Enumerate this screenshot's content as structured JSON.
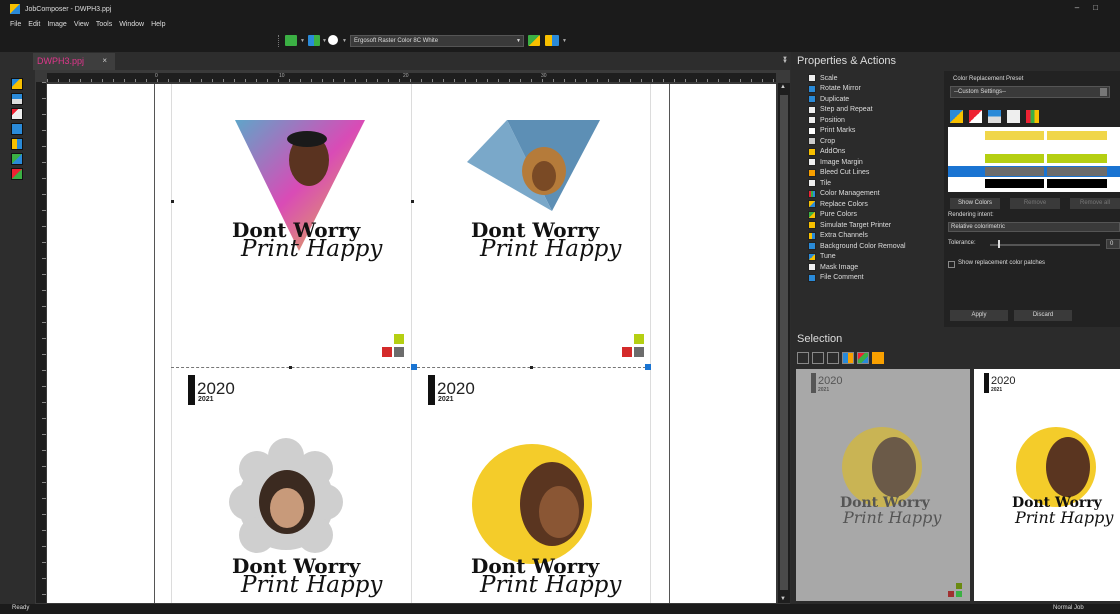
{
  "app": {
    "title": "JobComposer - DWPH3.ppj"
  },
  "menu": [
    "File",
    "Edit",
    "Image",
    "View",
    "Tools",
    "Window",
    "Help"
  ],
  "toolbar": {
    "printer": "Ergosoft Raster Color 8C White"
  },
  "document": {
    "tab_label": "DWPH3.ppj",
    "ruler_unit": "Centimeter",
    "ruler_labels": [
      "0",
      "10",
      "20",
      "30"
    ],
    "tiles": [
      {
        "headline": "Dont Worry",
        "script": "Print Happy",
        "year": "2020",
        "year_sub": "2021"
      },
      {
        "headline": "Dont Worry",
        "script": "Print Happy",
        "year": "2020",
        "year_sub": "2021"
      },
      {
        "headline": "Dont Worry",
        "script": "Print Happy"
      },
      {
        "headline": "Dont Worry",
        "script": "Print Happy"
      }
    ]
  },
  "properties": {
    "title": "Properties & Actions",
    "actions": [
      "Scale",
      "Rotate Mirror",
      "Duplicate",
      "Step and Repeat",
      "Position",
      "Print Marks",
      "Crop",
      "AddOns",
      "Image Margin",
      "Bleed Cut Lines",
      "Tile",
      "Color Management",
      "Replace Colors",
      "Pure Colors",
      "Simulate Target Printer",
      "Extra Channels",
      "Background Color Removal",
      "Tune",
      "Mask Image",
      "File Comment"
    ],
    "color_replacement": {
      "label": "Color Replacement Preset",
      "preset": "--Custom Settings--",
      "show_colors": "Show Colors",
      "remove": "Remove",
      "remove_all": "Remove all",
      "rendering_intent_label": "Rendering intent:",
      "rendering_intent": "Relative colorimetric",
      "tolerance_label": "Tolerance:",
      "tolerance_value": "0",
      "show_patches": "Show replacement color patches",
      "apply": "Apply",
      "discard": "Discard"
    }
  },
  "selection": {
    "title": "Selection",
    "thumbs": [
      {
        "year": "2020",
        "year_sub": "2021",
        "headline": "Dont Worry",
        "script": "Print Happy"
      },
      {
        "year": "2020",
        "year_sub": "2021",
        "headline": "Dont Worry",
        "script": "Print Happy"
      }
    ]
  },
  "status": {
    "left": "Ready",
    "right": "Normal Job"
  },
  "colors": {
    "accent": "#e0368c",
    "selection_blue": "#1a74d2",
    "swatch_yellow": "#f0d64a",
    "swatch_green": "#b5cf12",
    "swatch_gray": "#6c6c6c"
  }
}
